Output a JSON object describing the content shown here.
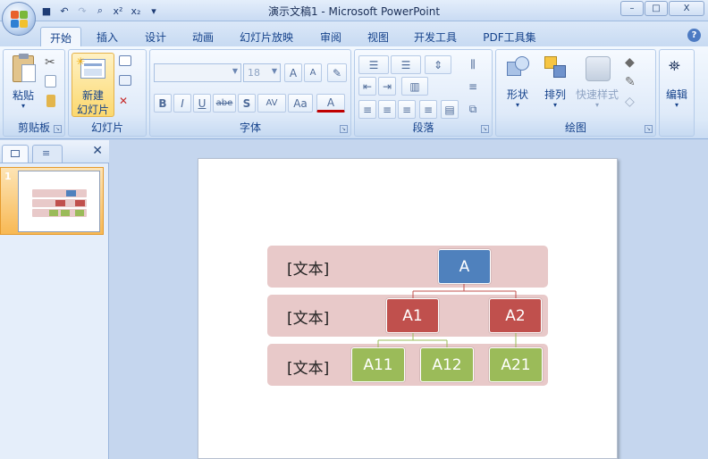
{
  "window": {
    "title": "演示文稿1 - Microsoft PowerPoint",
    "minimize": "–",
    "restore": "□",
    "close": "X"
  },
  "qat": [
    "save-icon",
    "undo-icon",
    "redo-icon",
    "print-preview-icon",
    "superscript-icon",
    "subscript-icon",
    "customize-icon"
  ],
  "qat_glyphs": [
    "■",
    "↶",
    "↷",
    "⌕",
    "x²",
    "x₂",
    "▾"
  ],
  "tabs": [
    "开始",
    "插入",
    "设计",
    "动画",
    "幻灯片放映",
    "审阅",
    "视图",
    "开发工具",
    "PDF工具集"
  ],
  "help": "?",
  "ribbon": {
    "clipboard": {
      "label": "剪贴板",
      "paste": "粘贴"
    },
    "slides": {
      "label": "幻灯片",
      "new_slide_line1": "新建",
      "new_slide_line2": "幻灯片"
    },
    "font": {
      "label": "字体",
      "font_name": "",
      "font_size": "18",
      "bold": "B",
      "italic": "I",
      "underline": "U",
      "strike": "abe",
      "shadow": "S",
      "spacing": "AV",
      "case": "Aa",
      "color": "A",
      "grow": "A",
      "shrink": "A"
    },
    "paragraph": {
      "label": "段落"
    },
    "drawing": {
      "label": "绘图",
      "shapes": "形状",
      "arrange": "排列",
      "quick_styles": "快速样式"
    },
    "editing": {
      "label": "编辑"
    }
  },
  "slide_panel": {
    "slide_number": "1"
  },
  "slide": {
    "rows": [
      {
        "text": "[文本]"
      },
      {
        "text": "[文本]"
      },
      {
        "text": "[文本]"
      }
    ],
    "nodes": {
      "root": "A",
      "level2": [
        "A1",
        "A2"
      ],
      "level3": [
        "A11",
        "A12",
        "A21"
      ]
    },
    "colors": {
      "band": "#e8c9c9",
      "root": "#4f81bd",
      "level2": "#c0504d",
      "level3": "#9bbb59"
    }
  }
}
